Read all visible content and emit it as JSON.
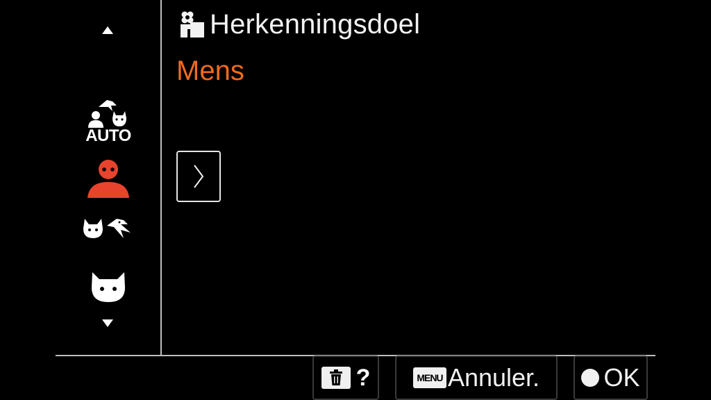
{
  "header": {
    "title": "Herkenningsdoel",
    "title_icon": "subject-recognition-icon",
    "selected_value": "Mens"
  },
  "options": [
    {
      "id": "auto",
      "label": "AUTO",
      "icon": "auto-subject-icon",
      "selected": false
    },
    {
      "id": "human",
      "icon": "human-icon",
      "selected": true
    },
    {
      "id": "animal-bird",
      "icon": "animal-bird-icon",
      "selected": false
    },
    {
      "id": "animal",
      "icon": "animal-icon",
      "selected": false
    }
  ],
  "footer": {
    "help_label": "?",
    "menu_key": "MENU",
    "cancel_label": "Annuler.",
    "ok_label": "OK"
  },
  "colors": {
    "background": "#000000",
    "accent": "#ee6b1e",
    "selected_icon": "#e8432d",
    "foreground": "#ffffff"
  }
}
